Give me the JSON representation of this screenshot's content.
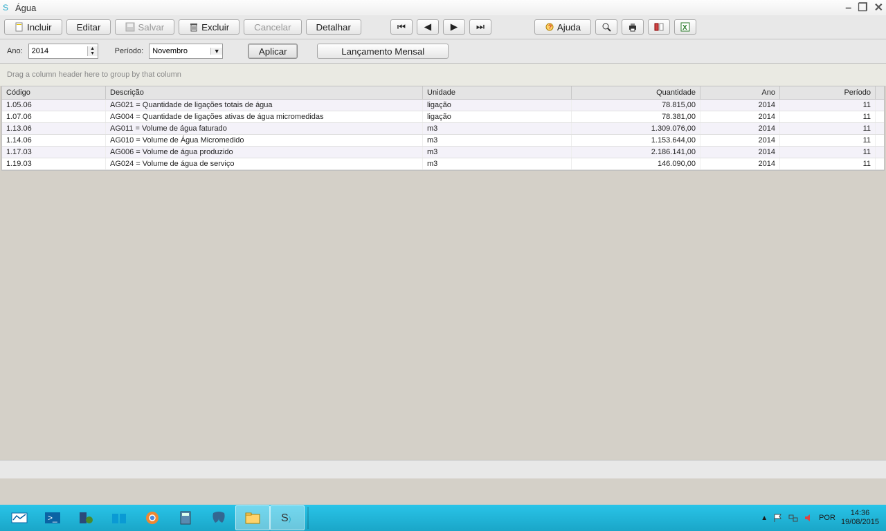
{
  "window": {
    "title": "Água"
  },
  "toolbar": {
    "incluir": "Incluir",
    "editar": "Editar",
    "salvar": "Salvar",
    "excluir": "Excluir",
    "cancelar": "Cancelar",
    "detalhar": "Detalhar",
    "ajuda": "Ajuda"
  },
  "filter": {
    "ano_label": "Ano:",
    "ano_value": "2014",
    "periodo_label": "Período:",
    "periodo_value": "Novembro",
    "aplicar": "Aplicar",
    "lancamento": "Lançamento Mensal"
  },
  "grid": {
    "group_hint": "Drag a column header here to group by that column",
    "headers": {
      "codigo": "Código",
      "descricao": "Descrição",
      "unidade": "Unidade",
      "quantidade": "Quantidade",
      "ano": "Ano",
      "periodo": "Período"
    },
    "rows": [
      {
        "codigo": "1.05.06",
        "descricao": "AG021 = Quantidade de ligações totais de água",
        "unidade": "ligação",
        "quantidade": "78.815,00",
        "ano": "2014",
        "periodo": "11"
      },
      {
        "codigo": "1.07.06",
        "descricao": "AG004 = Quantidade de ligações ativas de água micromedidas",
        "unidade": "ligação",
        "quantidade": "78.381,00",
        "ano": "2014",
        "periodo": "11"
      },
      {
        "codigo": "1.13.06",
        "descricao": "AG011 = Volume de água faturado",
        "unidade": "m3",
        "quantidade": "1.309.076,00",
        "ano": "2014",
        "periodo": "11"
      },
      {
        "codigo": "1.14.06",
        "descricao": "AG010 = Volume de Água Micromedido",
        "unidade": "m3",
        "quantidade": "1.153.644,00",
        "ano": "2014",
        "periodo": "11"
      },
      {
        "codigo": "1.17.03",
        "descricao": "AG006 = Volume de água produzido",
        "unidade": "m3",
        "quantidade": "2.186.141,00",
        "ano": "2014",
        "periodo": "11"
      },
      {
        "codigo": "1.19.03",
        "descricao": "AG024 = Volume de água de serviço",
        "unidade": "m3",
        "quantidade": "146.090,00",
        "ano": "2014",
        "periodo": "11"
      }
    ]
  },
  "tray": {
    "lang": "POR",
    "time": "14:36",
    "date": "19/08/2015"
  }
}
